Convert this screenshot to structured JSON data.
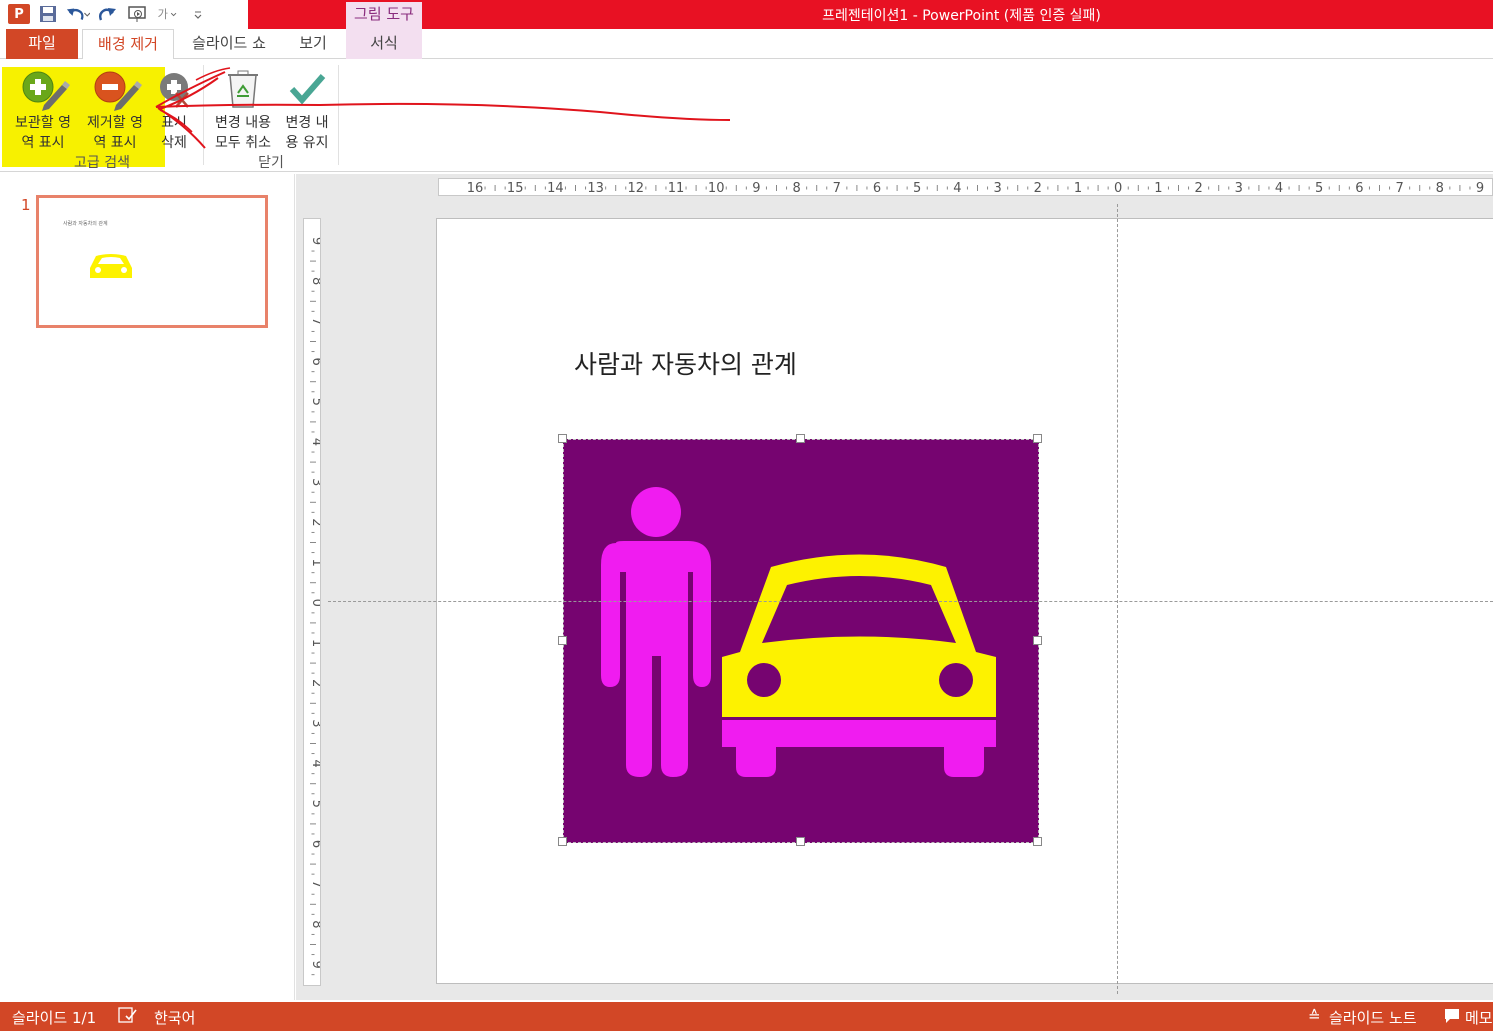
{
  "window": {
    "title": "프레젠테이션1 -  PowerPoint (제품 인증 실패)",
    "tool_tab": "그림 도구"
  },
  "tabs": {
    "file": "파일",
    "background_removal": "배경 제거",
    "slideshow": "슬라이드 쇼",
    "view": "보기",
    "format": "서식"
  },
  "ribbon": {
    "mark_keep": "보관할 영\n역 표시",
    "mark_remove": "제거할 영\n역 표시",
    "delete_mark": "표시\n삭제",
    "discard_changes": "변경 내용\n모두 취소",
    "keep_changes": "변경 내\n용 유지",
    "group_refine": "고급 검색",
    "group_close": "닫기"
  },
  "thumbnails": {
    "number": "1",
    "title": "사람과 자동차의 관계"
  },
  "slide": {
    "title": "사람과 자동차의 관계"
  },
  "ruler": {
    "horizontal": [
      "16",
      "15",
      "14",
      "13",
      "12",
      "11",
      "10",
      "9",
      "8",
      "7",
      "6",
      "5",
      "4",
      "3",
      "2",
      "1",
      "0",
      "1",
      "2",
      "3",
      "4",
      "5",
      "6",
      "7",
      "8",
      "9"
    ],
    "vertical": [
      "9",
      "8",
      "7",
      "6",
      "5",
      "4",
      "3",
      "2",
      "1",
      "0",
      "1",
      "2",
      "3",
      "4",
      "5",
      "6",
      "7",
      "8",
      "9"
    ]
  },
  "status": {
    "slide_count": "슬라이드 1/1",
    "language": "한국어",
    "notes": "슬라이드 노트",
    "comments": "메모"
  },
  "colors": {
    "accent": "#d24726",
    "titlebar": "#e81123",
    "picture_bg": "#760470",
    "figure_magenta": "#f01cf0",
    "car_yellow": "#fdf200",
    "annotation_highlight": "#f7f100",
    "annotation_stroke": "#e0141c"
  }
}
